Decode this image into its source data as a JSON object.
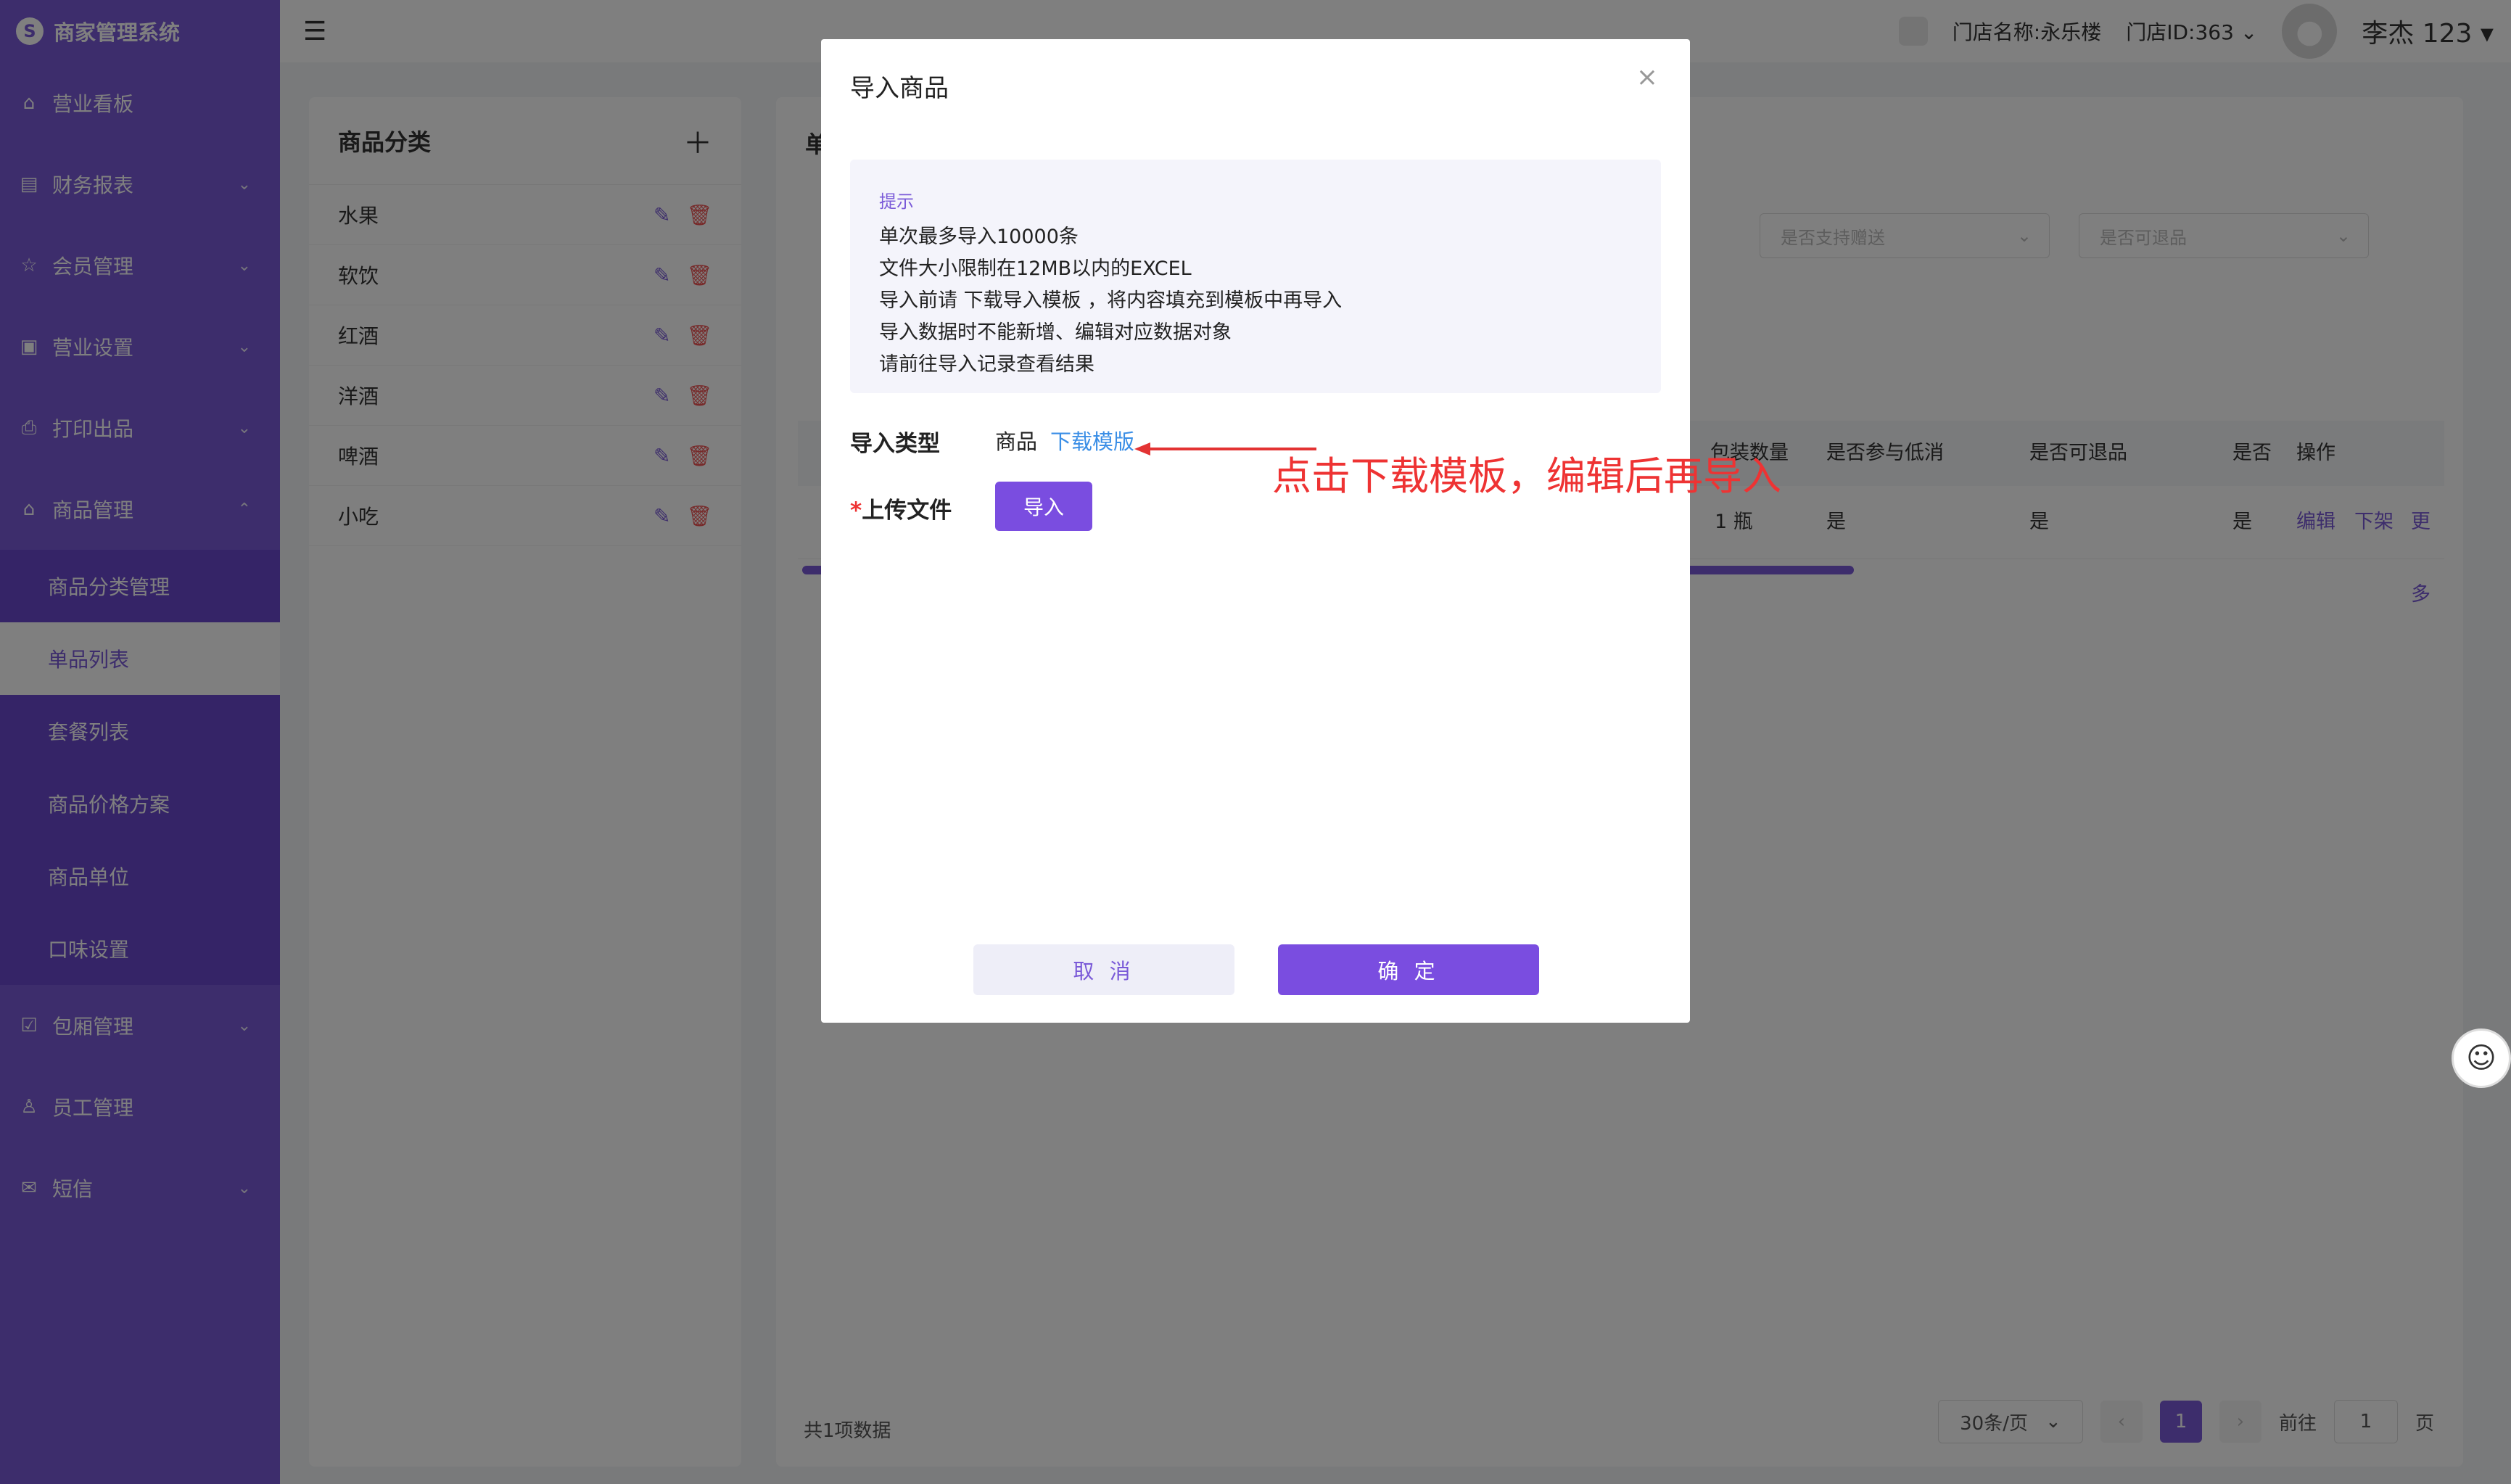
{
  "sidebar": {
    "brand": "商家管理系统",
    "items": [
      {
        "label": "营业看板",
        "icon": "home-icon"
      },
      {
        "label": "财务报表",
        "icon": "report-icon"
      },
      {
        "label": "会员管理",
        "icon": "member-icon"
      },
      {
        "label": "营业设置",
        "icon": "settings-icon"
      },
      {
        "label": "打印出品",
        "icon": "printer-icon"
      },
      {
        "label": "商品管理",
        "icon": "goods-icon"
      }
    ],
    "submenu": [
      "商品分类管理",
      "单品列表",
      "套餐列表",
      "商品价格方案",
      "商品单位",
      "口味设置"
    ],
    "items_bottom": [
      {
        "label": "包厢管理",
        "icon": "room-icon"
      },
      {
        "label": "员工管理",
        "icon": "staff-icon"
      },
      {
        "label": "短信",
        "icon": "mail-icon"
      }
    ]
  },
  "header": {
    "store_name": "门店名称:永乐楼",
    "store_id": "门店ID:363",
    "user_name": "李杰 123"
  },
  "category_panel": {
    "title": "商品分类",
    "items": [
      "水果",
      "软饮",
      "红酒",
      "洋酒",
      "啤酒",
      "小吃"
    ]
  },
  "main": {
    "title": "单",
    "filters": [
      "是否支持赠送",
      "是否可退品"
    ],
    "columns": [
      "包装数量",
      "是否参与低消",
      "是否可退品",
      "是否",
      "操作"
    ],
    "row": {
      "unit": "1 瓶",
      "min_spend": "是",
      "returnable": "是",
      "other": "是",
      "actions": [
        "编辑",
        "下架",
        "更多"
      ]
    },
    "total": "共1项数据",
    "pager": {
      "page_size": "30条/页",
      "current": "1",
      "goto_label": "前往",
      "goto_value": "1",
      "page_suffix": "页"
    }
  },
  "modal": {
    "title": "导入商品",
    "tips_title": "提示",
    "tips": [
      "单次最多导入10000条",
      "文件大小限制在12MB以内的EXCEL",
      "导入前请 下载导入模板 ，将内容填充到模板中再导入",
      "导入数据时不能新增、编辑对应数据对象",
      "请前往导入记录查看结果"
    ],
    "type_label": "导入类型",
    "type_value": "商品",
    "download_link": "下载模版",
    "upload_label": "上传文件",
    "upload_button": "导入",
    "cancel": "取 消",
    "confirm": "确 定"
  },
  "annotation": "点击下载模板，编辑后再导入",
  "colors": {
    "primary": "#7a4de0",
    "sidebar": "#7a5ad8",
    "link": "#3a8ee6",
    "annotation": "#e33333"
  }
}
